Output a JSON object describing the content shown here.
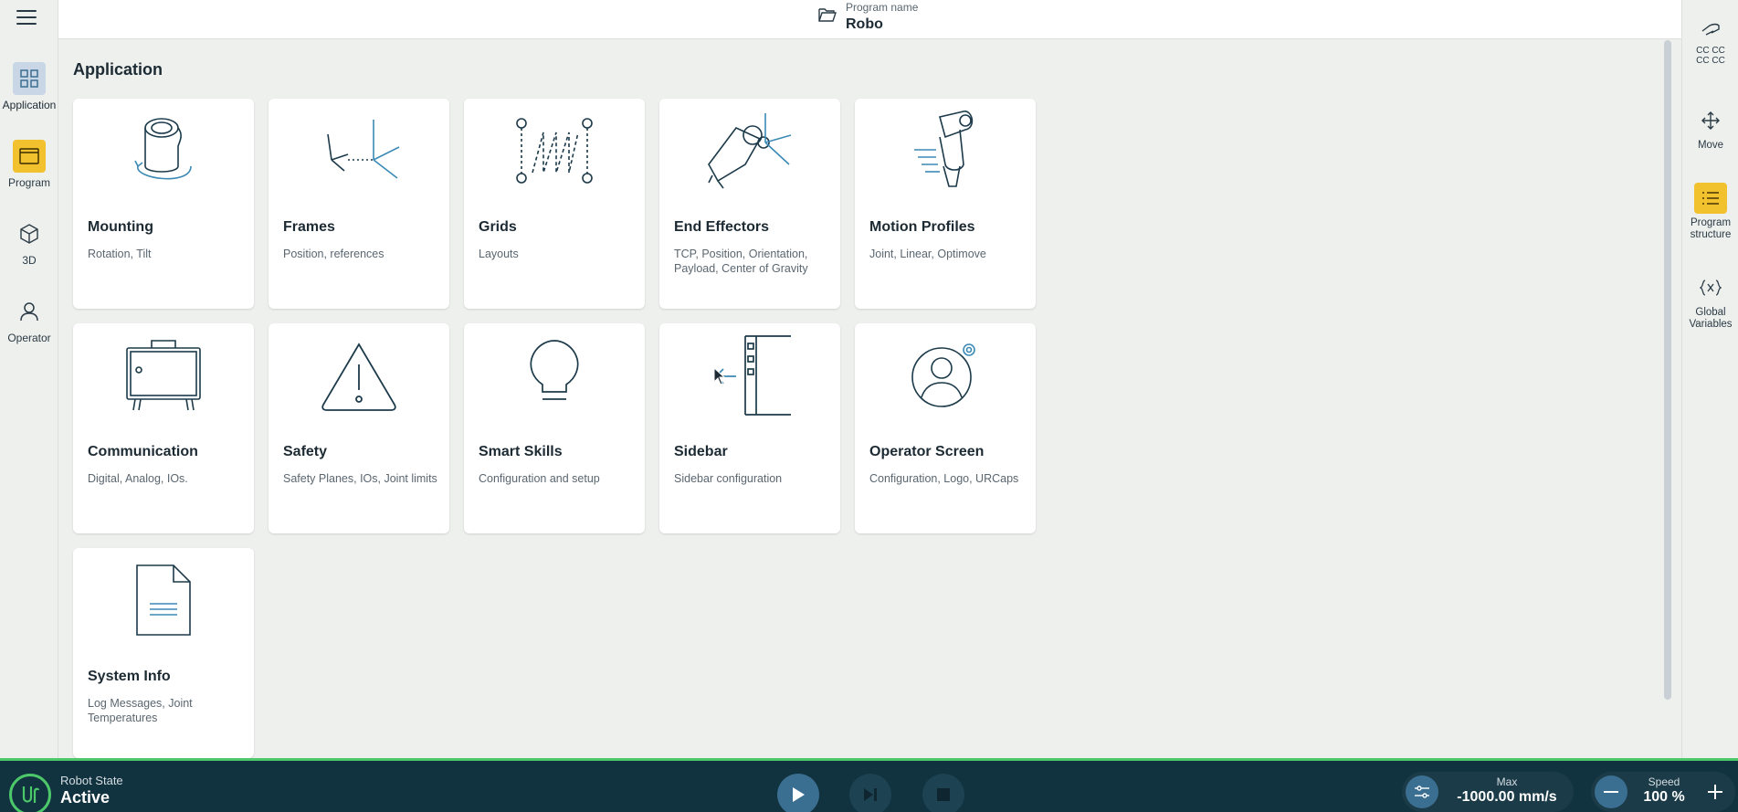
{
  "header": {
    "program_name_label": "Program name",
    "program_name": "Robo"
  },
  "left_nav": {
    "items": [
      {
        "label": "Application",
        "icon": "grid-icon"
      },
      {
        "label": "Program",
        "icon": "program-window-icon"
      },
      {
        "label": "3D",
        "icon": "cube-icon"
      },
      {
        "label": "Operator",
        "icon": "person-icon"
      }
    ]
  },
  "main": {
    "title": "Application",
    "cards": [
      {
        "title": "Mounting",
        "subtitle": "Rotation, Tilt"
      },
      {
        "title": "Frames",
        "subtitle": "Position, references"
      },
      {
        "title": "Grids",
        "subtitle": "Layouts"
      },
      {
        "title": "End Effectors",
        "subtitle": "TCP, Position, Orientation, Payload, Center of Gravity"
      },
      {
        "title": "Motion Profiles",
        "subtitle": "Joint, Linear, Optimove"
      },
      {
        "title": "Communication",
        "subtitle": "Digital, Analog, IOs."
      },
      {
        "title": "Safety",
        "subtitle": "Safety Planes, IOs, Joint limits"
      },
      {
        "title": "Smart Skills",
        "subtitle": "Configuration and setup"
      },
      {
        "title": "Sidebar",
        "subtitle": "Sidebar configuration"
      },
      {
        "title": "Operator Screen",
        "subtitle": "Configuration, Logo, URCaps"
      },
      {
        "title": "System Info",
        "subtitle": "Log Messages, Joint Temperatures"
      }
    ]
  },
  "right_nav": {
    "cc_line1": "CC CC",
    "cc_line2": "CC CC",
    "items": [
      {
        "label": "Move"
      },
      {
        "label": "Program structure"
      },
      {
        "label": "Global Variables"
      }
    ]
  },
  "bottom_bar": {
    "robot_state_label": "Robot State",
    "robot_state_value": "Active",
    "max_label": "Max",
    "max_value": "-1000.00 mm/s",
    "speed_label": "Speed",
    "speed_value": "100 %"
  },
  "colors": {
    "accent_yellow": "#f2c12e",
    "active_blue": "#c8d6e6",
    "bottom_bar": "#11323f",
    "status_green": "#4cc76a"
  }
}
